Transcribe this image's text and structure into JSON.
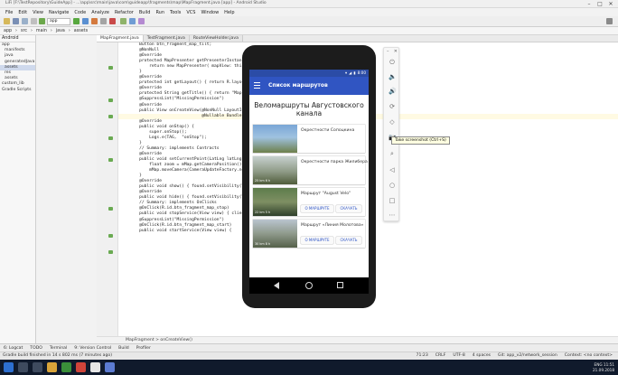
{
  "window": {
    "title": "LiFi [F:\\TestRepository\\GuideApp] - ...\\app\\src\\main\\java\\com\\guideapp\\fragments\\map\\MapFragment.java [app] - Android Studio",
    "min": "–",
    "max": "□",
    "close": "✕"
  },
  "menu": [
    "File",
    "Edit",
    "View",
    "Navigate",
    "Code",
    "Analyze",
    "Refactor",
    "Build",
    "Run",
    "Tools",
    "VCS",
    "Window",
    "Help"
  ],
  "toolbar": {
    "run_config": "app"
  },
  "nav_path": [
    "app",
    "src",
    "main",
    "java",
    "assets"
  ],
  "project_panel": {
    "header": "Android",
    "items": [
      "app",
      "manifests",
      "java",
      "generatedJava",
      "assets",
      "res",
      "assets",
      "custom_lib",
      "Gradle Scripts"
    ]
  },
  "tabs": [
    "MapFragment.java",
    "TestFragment.java",
    "RouteViewHolder.java"
  ],
  "code_lines": [
    "    Button btn_fragment_map_tilt;",
    "",
    "    @NonNull",
    "    @Override",
    "    protected MapPresenter getPresenterInstance() {",
    "        return new MapPresenter( mapView: this, getContext());",
    "    }",
    "",
    "    @Override",
    "    protected int getLayout() { return R.layout.fragment_map; }",
    "",
    "    @Override",
    "    protected String getTitle() { return \"Map\"; }",
    "",
    "    @SuppressLint(\"MissingPermission\")",
    "    @Override",
    "    public View onCreateView(@NonNull LayoutInflater inflater,",
    "                             @Nullable Bundle savedInstanceState) {",
    "",
    "    @Override",
    "    public void onStop() {",
    "        super.onStop();",
    "        Logs.e(TAG,  \"onStop\");",
    "    }",
    "",
    "    // Summary: implements Contracts",
    "",
    "",
    "    @Override",
    "    public void setCurrentPoint(LatLng latLng) {",
    "        float zoom = mMap.getCameraPosition().zoom;",
    "        mMap.moveCamera(CameraUpdateFactory.newLatLngZoom(latLng, zoom));",
    "    }",
    "",
    "    @Override",
    "    public void show() { found.setVisibility(View.VISIBLE); }",
    "",
    "    @Override",
    "    public void hide() { found.setVisibility(View.GONE); }",
    "",
    "    // Summary: implements OnClicks",
    "",
    "",
    "    @OnClick(R.id.btn_fragment_map_stop)",
    "    public void stopService(View view) { client.disconnect(); }",
    "",
    "    @SuppressLint(\"MissingPermission\")",
    "    @OnClick(R.id.btn_fragment_map_start)",
    "    public void startService(View view) {"
  ],
  "breadcrumb": "MapFragment  >  onCreateView()",
  "toolwindows": [
    "6: Logcat",
    "TODO",
    "Terminal",
    "9: Version Control",
    "Build",
    "Profiler"
  ],
  "status": {
    "message": "Gradle build finished in 14 s 802 ms (7 minutes ago)",
    "right": [
      "71:23",
      "CRLF",
      "UTF-8",
      "4 spaces",
      "Git: app_v2/network_session",
      "Context: <no context>"
    ]
  },
  "tray": {
    "lang": "ENG",
    "time": "11:51",
    "date": "21.09.2018"
  },
  "phone": {
    "status_time": "8:00",
    "app_title": "Список маршрутов",
    "heading": "Веломаршруты Августовского канала",
    "cards": [
      {
        "name": "Окрестности Сопоцкина",
        "buttons": [],
        "meta": "",
        "img_top": "#7aa6d6",
        "img_bottom": "#6d7f4a"
      },
      {
        "name": "Окрестности парка Жилибера",
        "buttons": [],
        "meta": "25 km  6 h",
        "img_top": "#c7d1cf",
        "img_bottom": "#4f5c3a"
      },
      {
        "name": "Маршрут \"August Velo\"",
        "buttons": [
          "О МАРШРУТЕ",
          "СКАЧАТЬ"
        ],
        "meta": "22 km  5 h",
        "img_top": "#5d7c4b",
        "img_bottom": "#2f3f2a"
      },
      {
        "name": "Маршрут «Линия Молотова»",
        "buttons": [
          "О МАРШРУТЕ",
          "СКАЧАТЬ"
        ],
        "meta": "30 km  8 h",
        "img_top": "#b9c4cf",
        "img_bottom": "#55604a"
      }
    ]
  },
  "emulator": {
    "top_min": "–",
    "top_close": "✕",
    "icons": [
      "⏻",
      "🔈",
      "🔊",
      "⟳",
      "◇",
      "📷",
      "⌕",
      "◁",
      "○",
      "□",
      "⋯"
    ],
    "tooltip": "Take screenshot (Ctrl+S)"
  }
}
